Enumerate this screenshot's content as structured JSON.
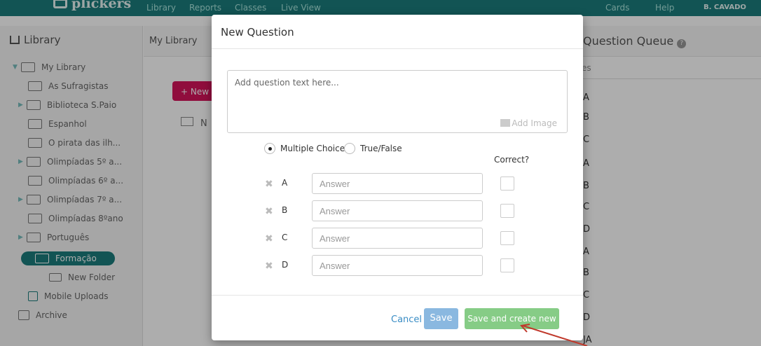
{
  "topbar": {
    "brand": "plickers",
    "nav": [
      "Library",
      "Reports",
      "Classes",
      "Live View"
    ],
    "right": [
      "Cards",
      "Help"
    ],
    "user": "B. CAVADO"
  },
  "sidebar": {
    "title": "Library",
    "items": [
      {
        "label": "My Library",
        "expanded": true
      },
      {
        "label": "As Sufragistas"
      },
      {
        "label": "Biblioteca S.Paio",
        "collapsed": true
      },
      {
        "label": "Espanhol"
      },
      {
        "label": "O pirata das ilh..."
      },
      {
        "label": "Olimpíadas 5º a...",
        "collapsed": true
      },
      {
        "label": "Olimpíadas 6º a..."
      },
      {
        "label": "Olimpíadas 7º a...",
        "collapsed": true
      },
      {
        "label": "Olimpíadas 8ºano"
      },
      {
        "label": "Português",
        "collapsed": true
      },
      {
        "label": "Formação",
        "selected": true
      },
      {
        "label": "New Folder"
      },
      {
        "label": "Mobile Uploads"
      },
      {
        "label": "Archive"
      }
    ]
  },
  "main": {
    "title": "My Library",
    "new_button": "+ New C",
    "folder_item": "N"
  },
  "queue": {
    "title": "Question Queue",
    "subtitle": "es",
    "items": [
      "A",
      "B",
      "C",
      "A",
      "B",
      "C",
      "D",
      "A",
      "B",
      "C",
      "D",
      "JA"
    ]
  },
  "modal": {
    "title": "New Question",
    "question_placeholder": "Add question text here...",
    "add_image": "Add Image",
    "type_options": [
      {
        "label": "Multiple Choice",
        "selected": true
      },
      {
        "label": "True/False",
        "selected": false
      }
    ],
    "correct_label": "Correct?",
    "answers": [
      {
        "letter": "A",
        "placeholder": "Answer"
      },
      {
        "letter": "B",
        "placeholder": "Answer"
      },
      {
        "letter": "C",
        "placeholder": "Answer"
      },
      {
        "letter": "D",
        "placeholder": "Answer"
      }
    ],
    "cancel": "Cancel",
    "save": "Save",
    "save_new": "Save and create new"
  },
  "colors": {
    "topbar": "#1b7d7d",
    "selected": "#1b7d7d",
    "new_button": "#d4145a",
    "save": "#8ab8e0",
    "save_new": "#86cc86",
    "annotation_arrow": "#c0392b"
  }
}
